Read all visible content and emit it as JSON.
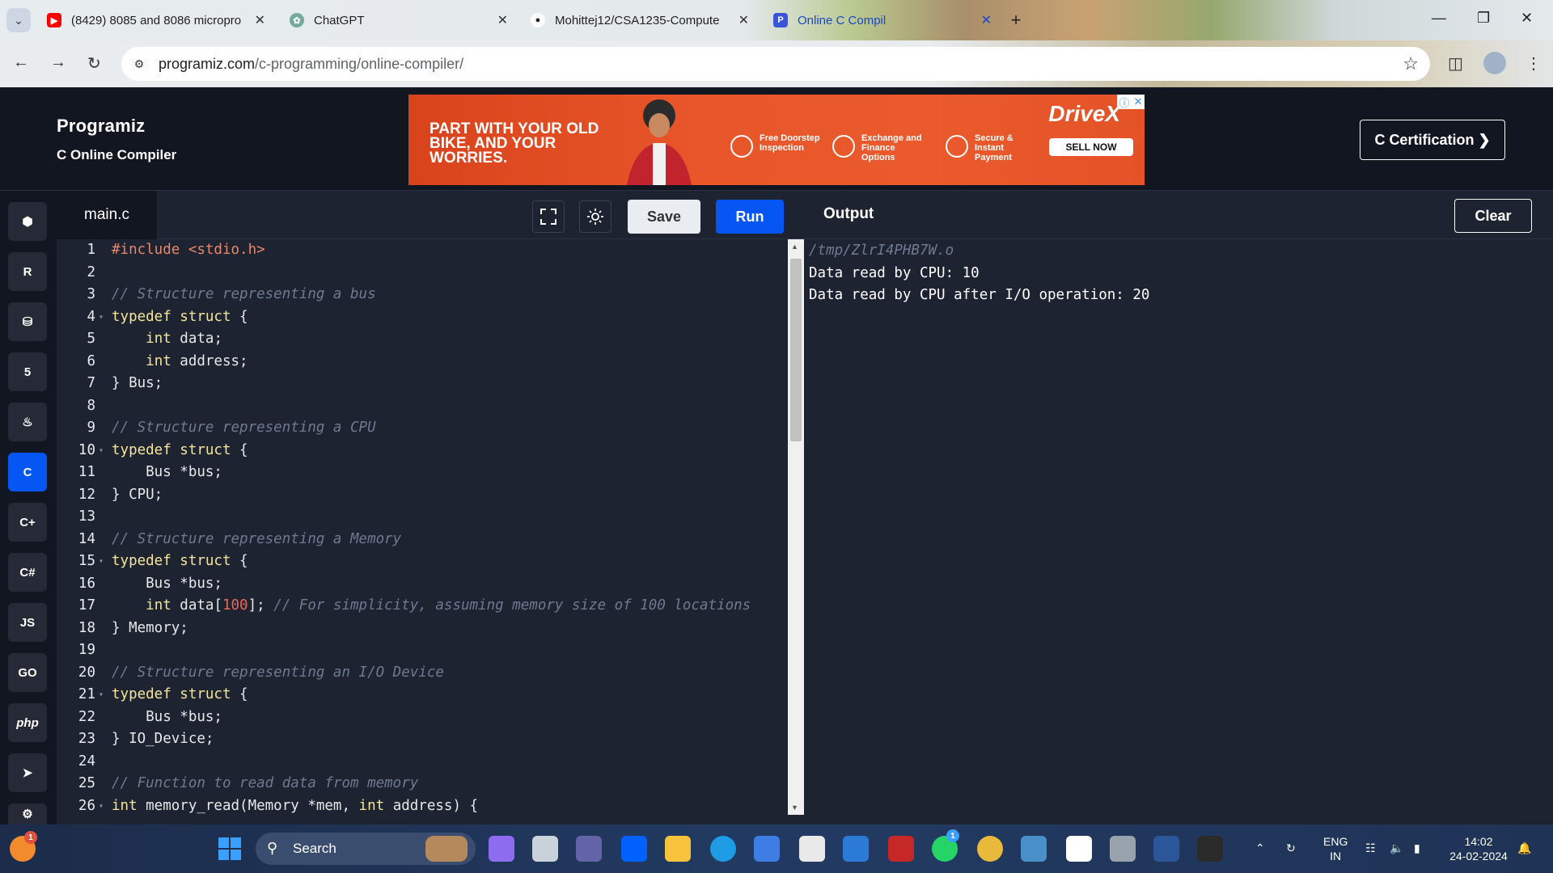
{
  "browser": {
    "tabs": [
      {
        "title": "(8429) 8085 and 8086 micropro",
        "favicon": "youtube-icon",
        "color": "#ff0000"
      },
      {
        "title": "ChatGPT",
        "favicon": "chatgpt-icon",
        "color": "#74aa9c"
      },
      {
        "title": "Mohittej12/CSA1235-Compute",
        "favicon": "github-icon",
        "color": "#ffffff"
      },
      {
        "title": "Online C Compil",
        "favicon": "programiz-icon",
        "color": "#3b55d8"
      }
    ],
    "url_domain": "programiz.com",
    "url_path": "/c-programming/online-compiler/"
  },
  "site": {
    "logo": "Programiz",
    "subtitle": "C Online Compiler",
    "cert_button": "C Certification ❯"
  },
  "ad": {
    "headline": "PART WITH YOUR OLD BIKE, AND YOUR WORRIES.",
    "features": [
      "Free Doorstep Inspection",
      "Exchange and Finance Options",
      "Secure & Instant Payment"
    ],
    "brand": "DriveX",
    "cta": "SELL NOW"
  },
  "sidebar": {
    "languages": [
      {
        "name": "python-icon",
        "glyph": "⬢"
      },
      {
        "name": "r-icon",
        "glyph": "R"
      },
      {
        "name": "sql-icon",
        "glyph": "⛁"
      },
      {
        "name": "html-icon",
        "glyph": "5"
      },
      {
        "name": "java-icon",
        "glyph": "♨"
      },
      {
        "name": "c-icon",
        "glyph": "C",
        "active": true
      },
      {
        "name": "cpp-icon",
        "glyph": "C+"
      },
      {
        "name": "csharp-icon",
        "glyph": "C#"
      },
      {
        "name": "js-icon",
        "glyph": "JS"
      },
      {
        "name": "go-icon",
        "glyph": "GO"
      },
      {
        "name": "php-icon",
        "glyph": "php"
      },
      {
        "name": "swift-icon",
        "glyph": "➤"
      },
      {
        "name": "rust-icon",
        "glyph": "⚙"
      }
    ]
  },
  "editor": {
    "filename": "main.c",
    "save_label": "Save",
    "run_label": "Run",
    "lines": [
      {
        "n": "1",
        "html": "<span class=\"pp\">#include &lt;stdio.h&gt;</span>"
      },
      {
        "n": "2",
        "html": ""
      },
      {
        "n": "3",
        "html": "<span class=\"cm\">// Structure representing a bus</span>"
      },
      {
        "n": "4",
        "fold": true,
        "html": "<span class=\"kw\">typedef struct</span> {"
      },
      {
        "n": "5",
        "html": "    <span class=\"kw\">int</span> data;"
      },
      {
        "n": "6",
        "html": "    <span class=\"kw\">int</span> address;"
      },
      {
        "n": "7",
        "html": "} Bus;"
      },
      {
        "n": "8",
        "html": ""
      },
      {
        "n": "9",
        "html": "<span class=\"cm\">// Structure representing a CPU</span>"
      },
      {
        "n": "10",
        "fold": true,
        "html": "<span class=\"kw\">typedef struct</span> {"
      },
      {
        "n": "11",
        "html": "    Bus *bus;"
      },
      {
        "n": "12",
        "html": "} CPU;"
      },
      {
        "n": "13",
        "html": ""
      },
      {
        "n": "14",
        "html": "<span class=\"cm\">// Structure representing a Memory</span>"
      },
      {
        "n": "15",
        "fold": true,
        "html": "<span class=\"kw\">typedef struct</span> {"
      },
      {
        "n": "16",
        "html": "    Bus *bus;"
      },
      {
        "n": "17",
        "html": "    <span class=\"kw\">int</span> data[<span class=\"num\">100</span>]; <span class=\"cm\">// For simplicity, assuming memory size of 100 locations</span>"
      },
      {
        "n": "18",
        "html": "} Memory;"
      },
      {
        "n": "19",
        "html": ""
      },
      {
        "n": "20",
        "html": "<span class=\"cm\">// Structure representing an I/O Device</span>"
      },
      {
        "n": "21",
        "fold": true,
        "html": "<span class=\"kw\">typedef struct</span> {"
      },
      {
        "n": "22",
        "html": "    Bus *bus;"
      },
      {
        "n": "23",
        "html": "} IO_Device;"
      },
      {
        "n": "24",
        "html": ""
      },
      {
        "n": "25",
        "html": "<span class=\"cm\">// Function to read data from memory</span>"
      },
      {
        "n": "26",
        "fold": true,
        "html": "<span class=\"kw\">int</span> memory_read(Memory *mem, <span class=\"kw\">int</span> address) {"
      }
    ]
  },
  "output": {
    "title": "Output",
    "clear_label": "Clear",
    "lines": [
      {
        "text": "/tmp/ZlrI4PHB7W.o",
        "dim": true
      },
      {
        "text": "Data read by CPU: 10"
      },
      {
        "text": "Data read by CPU after I/O operation: 20"
      }
    ]
  },
  "taskbar": {
    "search_label": "Search",
    "lang_top": "ENG",
    "lang_bottom": "IN",
    "time": "14:02",
    "date": "24-02-2024",
    "notification_badge": "1",
    "whatsapp_badge": "1",
    "apps": [
      {
        "name": "start-icon",
        "color": "#3aa0ff"
      },
      {
        "name": "copilot-icon",
        "color": "#8d6cf0"
      },
      {
        "name": "task-view-icon",
        "color": "#c9d1db"
      },
      {
        "name": "teams-icon",
        "color": "#6264a7"
      },
      {
        "name": "dropbox-icon",
        "color": "#0061ff"
      },
      {
        "name": "file-explorer-icon",
        "color": "#f7c23c"
      },
      {
        "name": "edge-icon",
        "color": "#1f9ce6"
      },
      {
        "name": "store-icon",
        "color": "#3d7de4"
      },
      {
        "name": "amazon-icon",
        "color": "#e9e9e9"
      },
      {
        "name": "whiteboard-icon",
        "color": "#2b7bd6"
      },
      {
        "name": "devcpp-icon",
        "color": "#c62828"
      },
      {
        "name": "whatsapp-icon",
        "color": "#25d366"
      },
      {
        "name": "chrome-icon",
        "color": "#e8b93a"
      },
      {
        "name": "photos-icon",
        "color": "#4a90c8"
      },
      {
        "name": "media-player-icon",
        "color": "#ffffff"
      },
      {
        "name": "settings-icon",
        "color": "#9aa3ad"
      },
      {
        "name": "word-icon",
        "color": "#2b579a"
      },
      {
        "name": "terminal-icon",
        "color": "#2b2b2b"
      }
    ]
  }
}
